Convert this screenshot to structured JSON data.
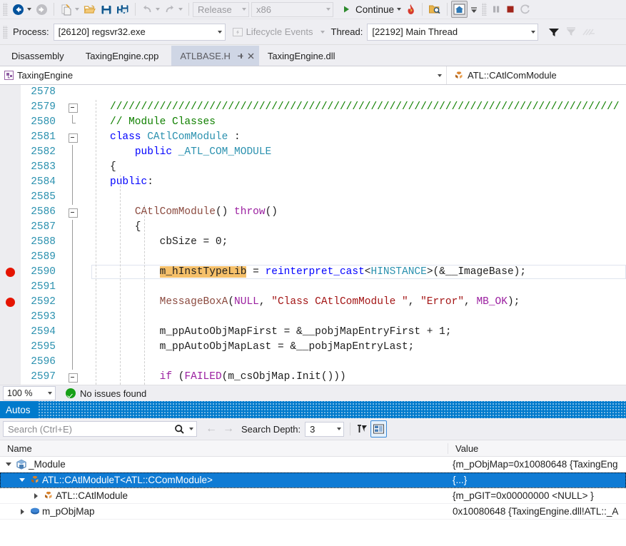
{
  "toolbar": {
    "nav_back": "navigate-backward",
    "nav_forward": "navigate-forward",
    "new_item": "new-item",
    "open_file": "open-file",
    "save": "save",
    "save_all": "save-all",
    "undo": "undo",
    "redo": "redo",
    "configuration": "Release",
    "platform": "x86",
    "continue_label": "Continue",
    "hot_reload": "hot-reload",
    "breakpoints": "breakpoints-window",
    "home": "home",
    "pause": "break-all",
    "stop": "stop-debugging",
    "restart": "restart"
  },
  "debugbar": {
    "process_label": "Process:",
    "process_value": "[26120] regsvr32.exe",
    "lifecycle_label": "Lifecycle Events",
    "thread_label": "Thread:",
    "thread_value": "[22192] Main Thread"
  },
  "tabs": [
    {
      "label": "Disassembly",
      "active": false
    },
    {
      "label": "TaxingEngine.cpp",
      "active": false
    },
    {
      "label": "ATLBASE.H",
      "active": true
    },
    {
      "label": "TaxingEngine.dll",
      "active": false
    }
  ],
  "navbar": {
    "project": "TaxingEngine",
    "scope": "ATL::CAtlComModule"
  },
  "editor": {
    "lines": [
      {
        "num": "2578",
        "bp": false,
        "outline": "",
        "tokens": []
      },
      {
        "num": "2579",
        "bp": false,
        "outline": "box",
        "tokens": [
          {
            "t": "//////////////////////////////////////////////////////////////////////////////////",
            "c": "c-cmt"
          }
        ]
      },
      {
        "num": "2580",
        "bp": false,
        "outline": "line-end",
        "tokens": [
          {
            "t": "// Module Classes",
            "c": "c-cmt"
          }
        ]
      },
      {
        "num": "2581",
        "bp": false,
        "outline": "box",
        "tokens": [
          {
            "t": "class ",
            "c": "c-kw"
          },
          {
            "t": "CAtlComModule",
            "c": "c-type"
          },
          {
            "t": " :",
            "c": "c-pl"
          }
        ]
      },
      {
        "num": "2582",
        "bp": false,
        "outline": "line",
        "tokens": [
          {
            "t": "    ",
            "c": "c-pl"
          },
          {
            "t": "public",
            "c": "c-kw"
          },
          {
            "t": " _ATL_COM_MODULE",
            "c": "c-type"
          }
        ]
      },
      {
        "num": "2583",
        "bp": false,
        "outline": "line",
        "tokens": [
          {
            "t": "{",
            "c": "c-pl"
          }
        ]
      },
      {
        "num": "2584",
        "bp": false,
        "outline": "line",
        "tokens": [
          {
            "t": "public",
            "c": "c-kw"
          },
          {
            "t": ":",
            "c": "c-pl"
          }
        ]
      },
      {
        "num": "2585",
        "bp": false,
        "outline": "line",
        "tokens": []
      },
      {
        "num": "2586",
        "bp": false,
        "outline": "box",
        "tokens": [
          {
            "t": "    ",
            "c": "c-pl"
          },
          {
            "t": "CAtlComModule",
            "c": "c-fn"
          },
          {
            "t": "() ",
            "c": "c-pl"
          },
          {
            "t": "throw",
            "c": "c-macro"
          },
          {
            "t": "()",
            "c": "c-pl"
          }
        ]
      },
      {
        "num": "2587",
        "bp": false,
        "outline": "line",
        "tokens": [
          {
            "t": "    {",
            "c": "c-pl"
          }
        ]
      },
      {
        "num": "2588",
        "bp": false,
        "outline": "line",
        "tokens": [
          {
            "t": "        cbSize = 0;",
            "c": "c-pl"
          }
        ]
      },
      {
        "num": "2589",
        "bp": false,
        "outline": "line",
        "tokens": []
      },
      {
        "num": "2590",
        "bp": true,
        "current": true,
        "outline": "line",
        "tokens": [
          {
            "t": "        ",
            "c": "c-pl"
          },
          {
            "t": "m_hInstTypeLib",
            "c": "c-pl hl"
          },
          {
            "t": " = ",
            "c": "c-pl"
          },
          {
            "t": "reinterpret_cast",
            "c": "c-kw"
          },
          {
            "t": "<",
            "c": "c-pl"
          },
          {
            "t": "HINSTANCE",
            "c": "c-type"
          },
          {
            "t": ">(&__ImageBase);",
            "c": "c-pl"
          }
        ]
      },
      {
        "num": "2591",
        "bp": false,
        "outline": "line",
        "tokens": []
      },
      {
        "num": "2592",
        "bp": true,
        "outline": "line",
        "tokens": [
          {
            "t": "        ",
            "c": "c-pl"
          },
          {
            "t": "MessageBoxA",
            "c": "c-fn"
          },
          {
            "t": "(",
            "c": "c-pl"
          },
          {
            "t": "NULL",
            "c": "c-macro"
          },
          {
            "t": ", ",
            "c": "c-pl"
          },
          {
            "t": "\"Class CAtlComModule \"",
            "c": "c-str"
          },
          {
            "t": ", ",
            "c": "c-pl"
          },
          {
            "t": "\"Error\"",
            "c": "c-str"
          },
          {
            "t": ", ",
            "c": "c-pl"
          },
          {
            "t": "MB_OK",
            "c": "c-macro"
          },
          {
            "t": ");",
            "c": "c-pl"
          }
        ]
      },
      {
        "num": "2593",
        "bp": false,
        "outline": "line",
        "tokens": []
      },
      {
        "num": "2594",
        "bp": false,
        "outline": "line",
        "tokens": [
          {
            "t": "        m_ppAutoObjMapFirst = &__pobjMapEntryFirst + 1;",
            "c": "c-pl"
          }
        ]
      },
      {
        "num": "2595",
        "bp": false,
        "outline": "line",
        "tokens": [
          {
            "t": "        m_ppAutoObjMapLast = &__pobjMapEntryLast;",
            "c": "c-pl"
          }
        ]
      },
      {
        "num": "2596",
        "bp": false,
        "outline": "line",
        "tokens": []
      },
      {
        "num": "2597",
        "bp": false,
        "outline": "box",
        "tokens": [
          {
            "t": "        ",
            "c": "c-pl"
          },
          {
            "t": "if",
            "c": "c-macro"
          },
          {
            "t": " (",
            "c": "c-pl"
          },
          {
            "t": "FAILED",
            "c": "c-macro"
          },
          {
            "t": "(m_csObjMap.",
            "c": "c-pl"
          },
          {
            "t": "Init",
            "c": "c-pl"
          },
          {
            "t": "()))",
            "c": "c-pl"
          }
        ]
      }
    ]
  },
  "status": {
    "zoom": "100 %",
    "issues": "No issues found"
  },
  "autos": {
    "title": "Autos",
    "search_placeholder": "Search (Ctrl+E)",
    "search_value": "",
    "search_icon": "magnifier-icon",
    "back_icon": "arrow-left-icon",
    "forward_icon": "arrow-right-icon",
    "depth_label": "Search Depth:",
    "depth_value": "3",
    "columns": [
      "Name",
      "Value"
    ],
    "rows": [
      {
        "indent": 1,
        "expander": "open",
        "icon": "module-icon",
        "name": "_Module",
        "value": "{m_pObjMap=0x10080648 {TaxingEng",
        "selected": false
      },
      {
        "indent": 2,
        "expander": "open",
        "icon": "class-icon",
        "name": "ATL::CAtlModuleT<ATL::CComModule>",
        "value": "{...}",
        "selected": true
      },
      {
        "indent": 3,
        "expander": "closed",
        "icon": "class-icon",
        "name": "ATL::CAtlModule",
        "value": "{m_pGIT=0x00000000 <NULL> }",
        "selected": false
      },
      {
        "indent": 2,
        "expander": "closed",
        "icon": "field-icon",
        "name": "m_pObjMap",
        "value": "0x10080648 {TaxingEngine.dll!ATL::_A",
        "selected": false
      }
    ]
  }
}
